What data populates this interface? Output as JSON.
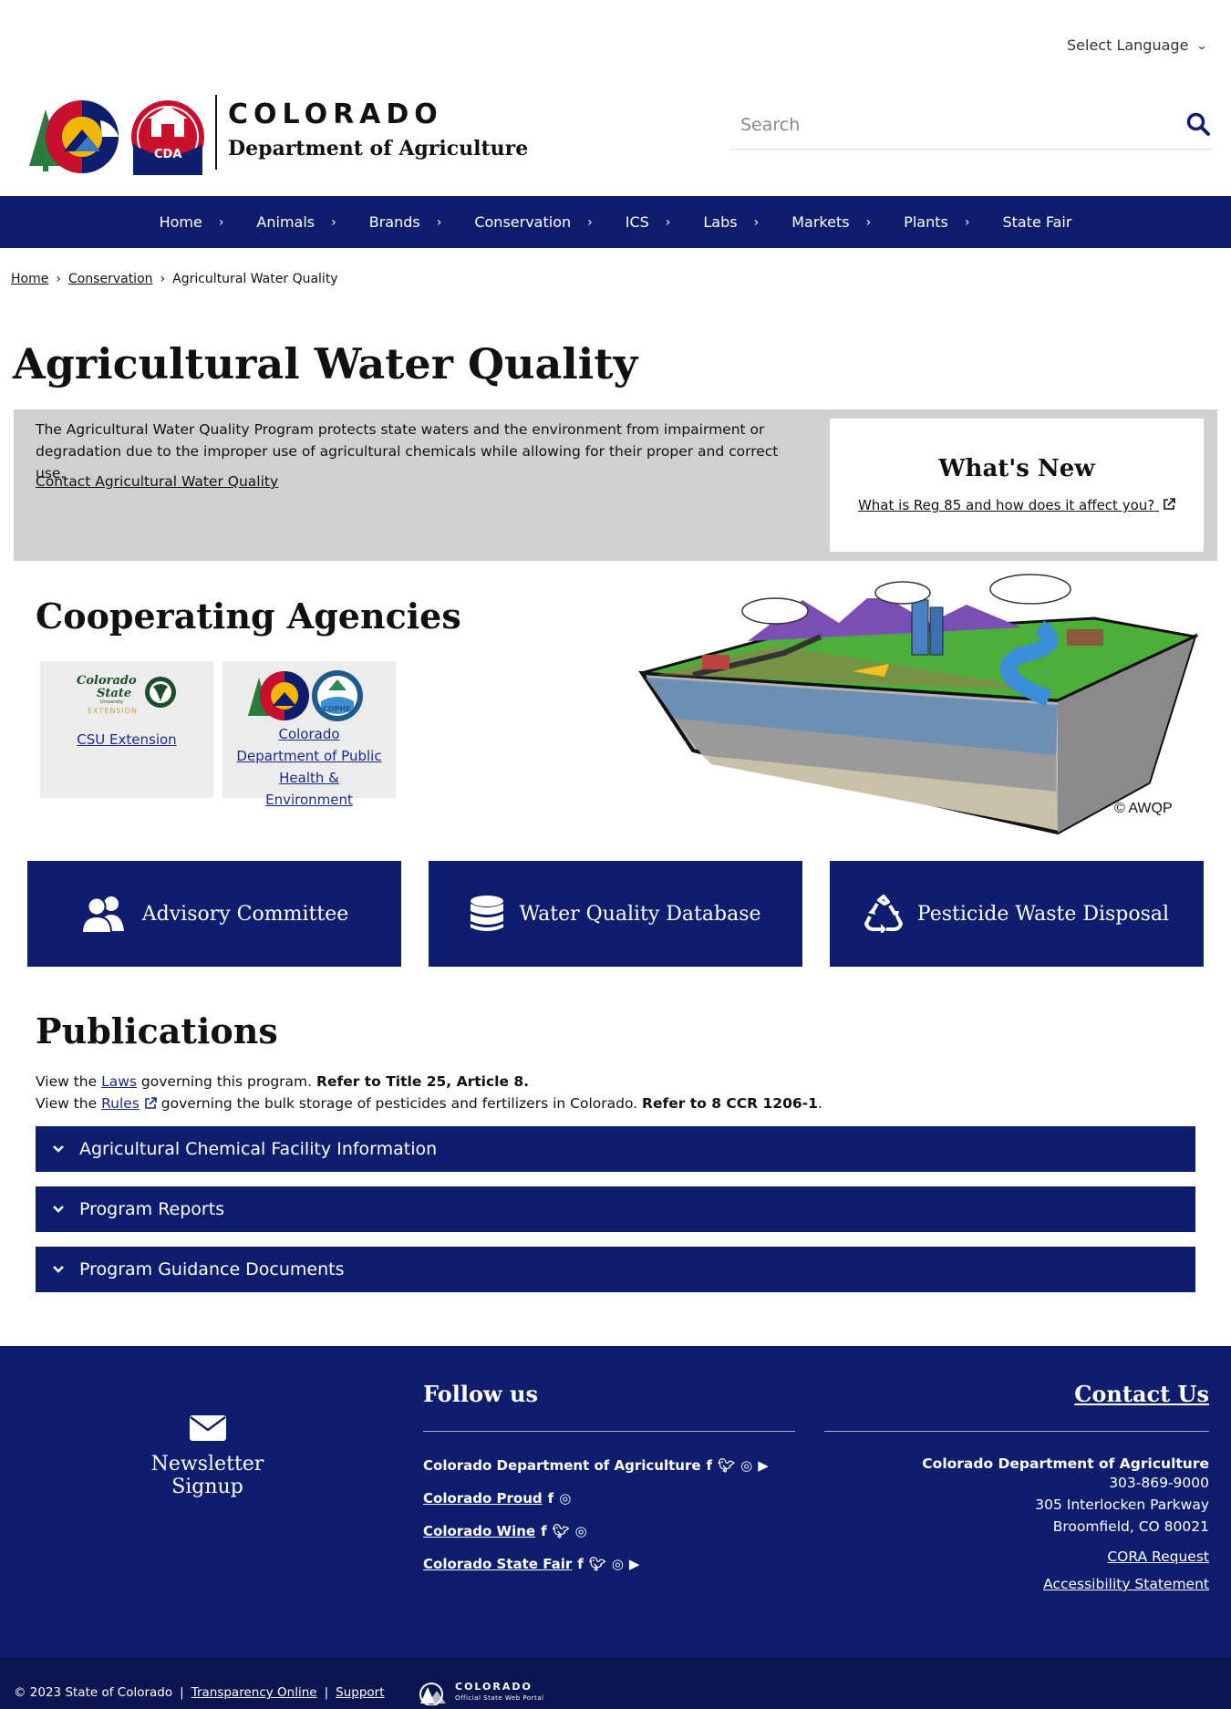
{
  "language": {
    "label": "Select Language"
  },
  "header": {
    "title": "COLORADO",
    "subtitle": "Department of Agriculture",
    "logo_text": "CDA",
    "search_placeholder": "Search"
  },
  "nav": {
    "items": [
      "Home",
      "Animals",
      "Brands",
      "Conservation",
      "ICS",
      "Labs",
      "Markets",
      "Plants",
      "State Fair"
    ]
  },
  "breadcrumb": {
    "items": [
      "Home",
      "Conservation"
    ],
    "current": "Agricultural Water Quality"
  },
  "page": {
    "title": "Agricultural Water Quality",
    "intro": "The Agricultural Water Quality Program protects state waters and the environment from impairment or degradation due to the improper use of agricultural chemicals while allowing for their proper and correct use.",
    "contact_link": "Contact Agricultural Water Quality"
  },
  "whats_new": {
    "title": "What's New",
    "link": "What is Reg 85 and how does it affect you?"
  },
  "agencies": {
    "title": "Cooperating Agencies",
    "items": [
      {
        "name": "CSU Extension",
        "logo_line1": "Colorado",
        "logo_line2": "State",
        "logo_line3": "University",
        "logo_line4": "EXTENSION"
      },
      {
        "name": "Colorado Department of Public Health & Environment",
        "logo_text": "CDPHE"
      }
    ]
  },
  "illustration": {
    "credit": "© AWQP"
  },
  "tiles": [
    {
      "label": "Advisory Committee",
      "icon": "users-icon"
    },
    {
      "label": "Water Quality Database",
      "icon": "database-icon"
    },
    {
      "label": "Pesticide Waste Disposal",
      "icon": "recycle-icon"
    }
  ],
  "publications": {
    "title": "Publications",
    "line1_prefix": "View the",
    "line1_link": "Laws",
    "line1_mid": "governing this program.",
    "line1_bold": "Refer to Title 25, Article 8.",
    "line2_prefix": "View the",
    "line2_link": "Rules",
    "line2_mid": "governing the bulk storage of pesticides and fertilizers in Colorado.",
    "line2_bold": "Refer to 8 CCR 1206-1",
    "line2_end": ".",
    "accordions": [
      "Agricultural Chemical Facility Information",
      "Program Reports",
      "Program Guidance Documents"
    ]
  },
  "footer": {
    "newsletter": "Newsletter Signup",
    "follow_title": "Follow us",
    "follow": [
      {
        "name": "Colorado Department of Agriculture",
        "icons": [
          "facebook-icon",
          "twitter-icon",
          "instagram-icon",
          "youtube-icon"
        ]
      },
      {
        "name": "Colorado Proud",
        "icons": [
          "facebook-icon",
          "instagram-icon"
        ]
      },
      {
        "name": "Colorado Wine",
        "icons": [
          "facebook-icon",
          "twitter-icon",
          "instagram-icon"
        ]
      },
      {
        "name": "Colorado State Fair",
        "icons": [
          "facebook-icon",
          "twitter-icon",
          "instagram-icon",
          "youtube-icon"
        ]
      }
    ],
    "contact_title": "Contact Us",
    "org": "Colorado Department of Agriculture",
    "phone": "303-869-9000",
    "address1": "305 Interlocken Parkway",
    "address2": "Broomfield, CO 80021",
    "cora": "CORA Request",
    "accessibility": "Accessibility Statement"
  },
  "subfooter": {
    "copyright": "© 2023 State of Colorado",
    "sep": "|",
    "transparency": "Transparency Online",
    "support": "Support",
    "portal_title": "COLORADO",
    "portal_sub": "Official State Web Portal"
  },
  "colors": {
    "navy": "#0f1d6e",
    "grey_box": "#d0d0d0",
    "card_bg": "#ececec"
  }
}
